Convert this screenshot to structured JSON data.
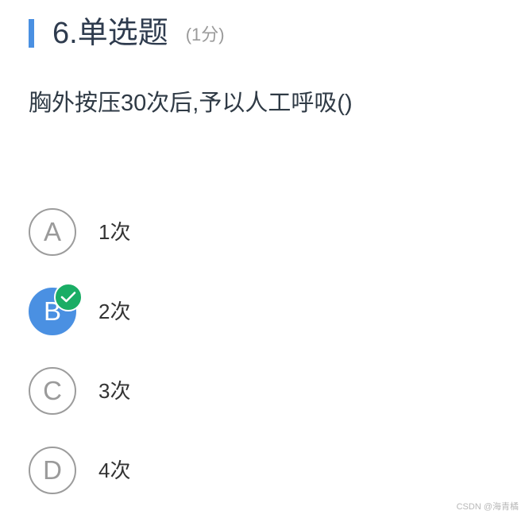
{
  "header": {
    "title": "6.单选题",
    "score": "(1分)"
  },
  "question": {
    "text": "胸外按压30次后,予以人工呼吸()"
  },
  "options": [
    {
      "letter": "A",
      "text": "1次",
      "selected": false
    },
    {
      "letter": "B",
      "text": "2次",
      "selected": true
    },
    {
      "letter": "C",
      "text": "3次",
      "selected": false
    },
    {
      "letter": "D",
      "text": "4次",
      "selected": false
    }
  ],
  "watermark": "CSDN @海青橘",
  "colors": {
    "accent": "#4a90e2",
    "check": "#1aad65"
  },
  "icons": {
    "selected_badge": "check-icon"
  }
}
